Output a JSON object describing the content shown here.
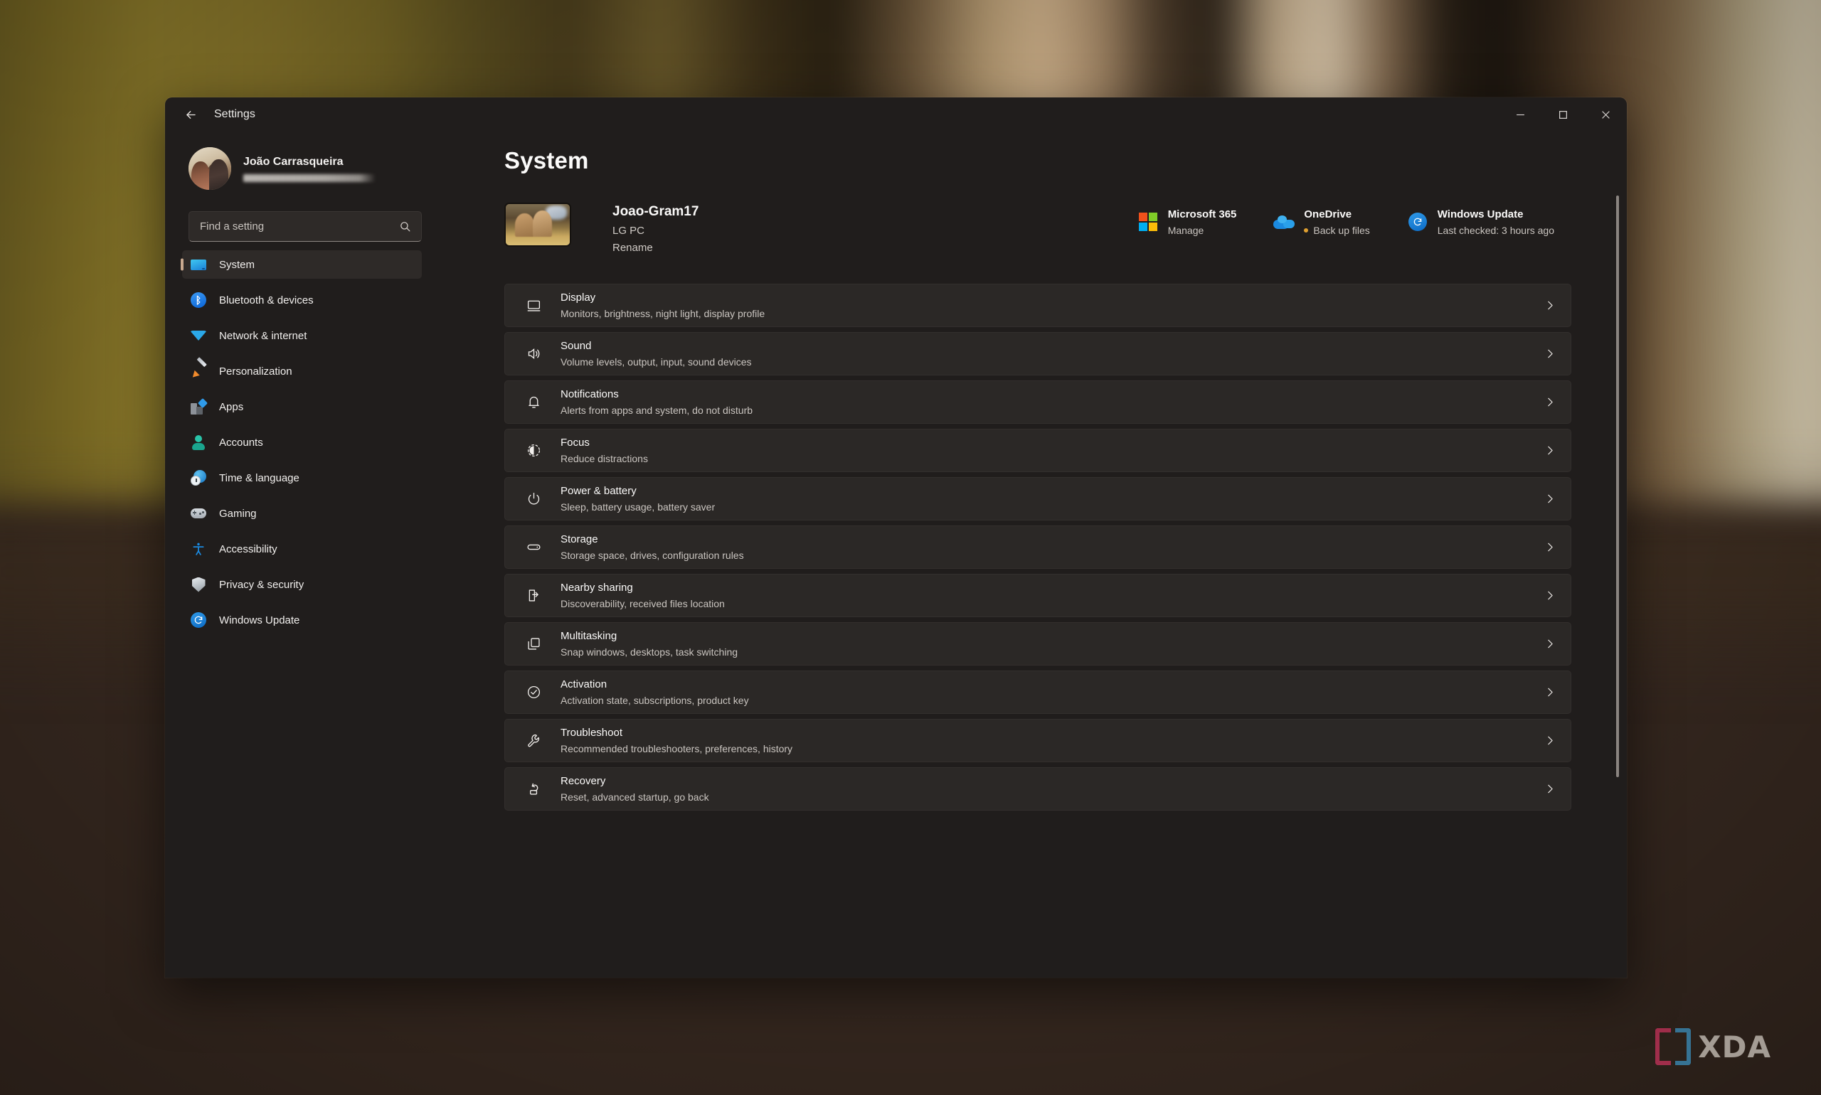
{
  "window": {
    "title": "Settings",
    "back_icon": "back-arrow-icon",
    "controls": {
      "minimize": "minimize-icon",
      "maximize": "maximize-icon",
      "close": "close-icon"
    }
  },
  "sidebar": {
    "account": {
      "name": "João Carrasqueira",
      "email_redacted": ""
    },
    "search": {
      "placeholder": "Find a setting",
      "value": "",
      "icon": "search-icon"
    },
    "items": [
      {
        "label": "System",
        "icon": "monitor-icon",
        "active": true
      },
      {
        "label": "Bluetooth & devices",
        "icon": "bluetooth-icon",
        "active": false
      },
      {
        "label": "Network & internet",
        "icon": "wifi-icon",
        "active": false
      },
      {
        "label": "Personalization",
        "icon": "paintbrush-icon",
        "active": false
      },
      {
        "label": "Apps",
        "icon": "apps-icon",
        "active": false
      },
      {
        "label": "Accounts",
        "icon": "person-icon",
        "active": false
      },
      {
        "label": "Time & language",
        "icon": "globe-clock-icon",
        "active": false
      },
      {
        "label": "Gaming",
        "icon": "gamepad-icon",
        "active": false
      },
      {
        "label": "Accessibility",
        "icon": "accessibility-icon",
        "active": false
      },
      {
        "label": "Privacy & security",
        "icon": "shield-icon",
        "active": false
      },
      {
        "label": "Windows Update",
        "icon": "sync-icon",
        "active": false
      }
    ]
  },
  "main": {
    "page_title": "System",
    "device": {
      "name": "Joao-Gram17",
      "model": "LG PC",
      "rename_label": "Rename"
    },
    "quicklinks": [
      {
        "title": "Microsoft 365",
        "sub": "Manage",
        "icon": "microsoft-365-icon",
        "dot": false
      },
      {
        "title": "OneDrive",
        "sub": "Back up files",
        "icon": "onedrive-icon",
        "dot": true,
        "dot_color": "#e0a030"
      },
      {
        "title": "Windows Update",
        "sub": "Last checked: 3 hours ago",
        "icon": "sync-icon",
        "dot": false
      }
    ],
    "settings_rows": [
      {
        "title": "Display",
        "sub": "Monitors, brightness, night light, display profile",
        "icon": "monitor-icon"
      },
      {
        "title": "Sound",
        "sub": "Volume levels, output, input, sound devices",
        "icon": "speaker-icon"
      },
      {
        "title": "Notifications",
        "sub": "Alerts from apps and system, do not disturb",
        "icon": "bell-icon"
      },
      {
        "title": "Focus",
        "sub": "Reduce distractions",
        "icon": "focus-icon"
      },
      {
        "title": "Power & battery",
        "sub": "Sleep, battery usage, battery saver",
        "icon": "power-icon"
      },
      {
        "title": "Storage",
        "sub": "Storage space, drives, configuration rules",
        "icon": "drive-icon"
      },
      {
        "title": "Nearby sharing",
        "sub": "Discoverability, received files location",
        "icon": "share-icon"
      },
      {
        "title": "Multitasking",
        "sub": "Snap windows, desktops, task switching",
        "icon": "windows-stack-icon"
      },
      {
        "title": "Activation",
        "sub": "Activation state, subscriptions, product key",
        "icon": "check-circle-icon"
      },
      {
        "title": "Troubleshoot",
        "sub": "Recommended troubleshooters, preferences, history",
        "icon": "wrench-icon"
      },
      {
        "title": "Recovery",
        "sub": "Reset, advanced startup, go back",
        "icon": "recovery-icon"
      }
    ],
    "chevron_icon": "chevron-right-icon"
  },
  "watermark": {
    "text": "XDA"
  },
  "colors": {
    "accent_active_bar": "#c8a98f",
    "window_bg": "#201d1c",
    "row_bg": "#2b2826",
    "text_primary": "#fbfaf9",
    "text_secondary": "#cac5c0",
    "onedrive_status_dot": "#e0a030"
  }
}
